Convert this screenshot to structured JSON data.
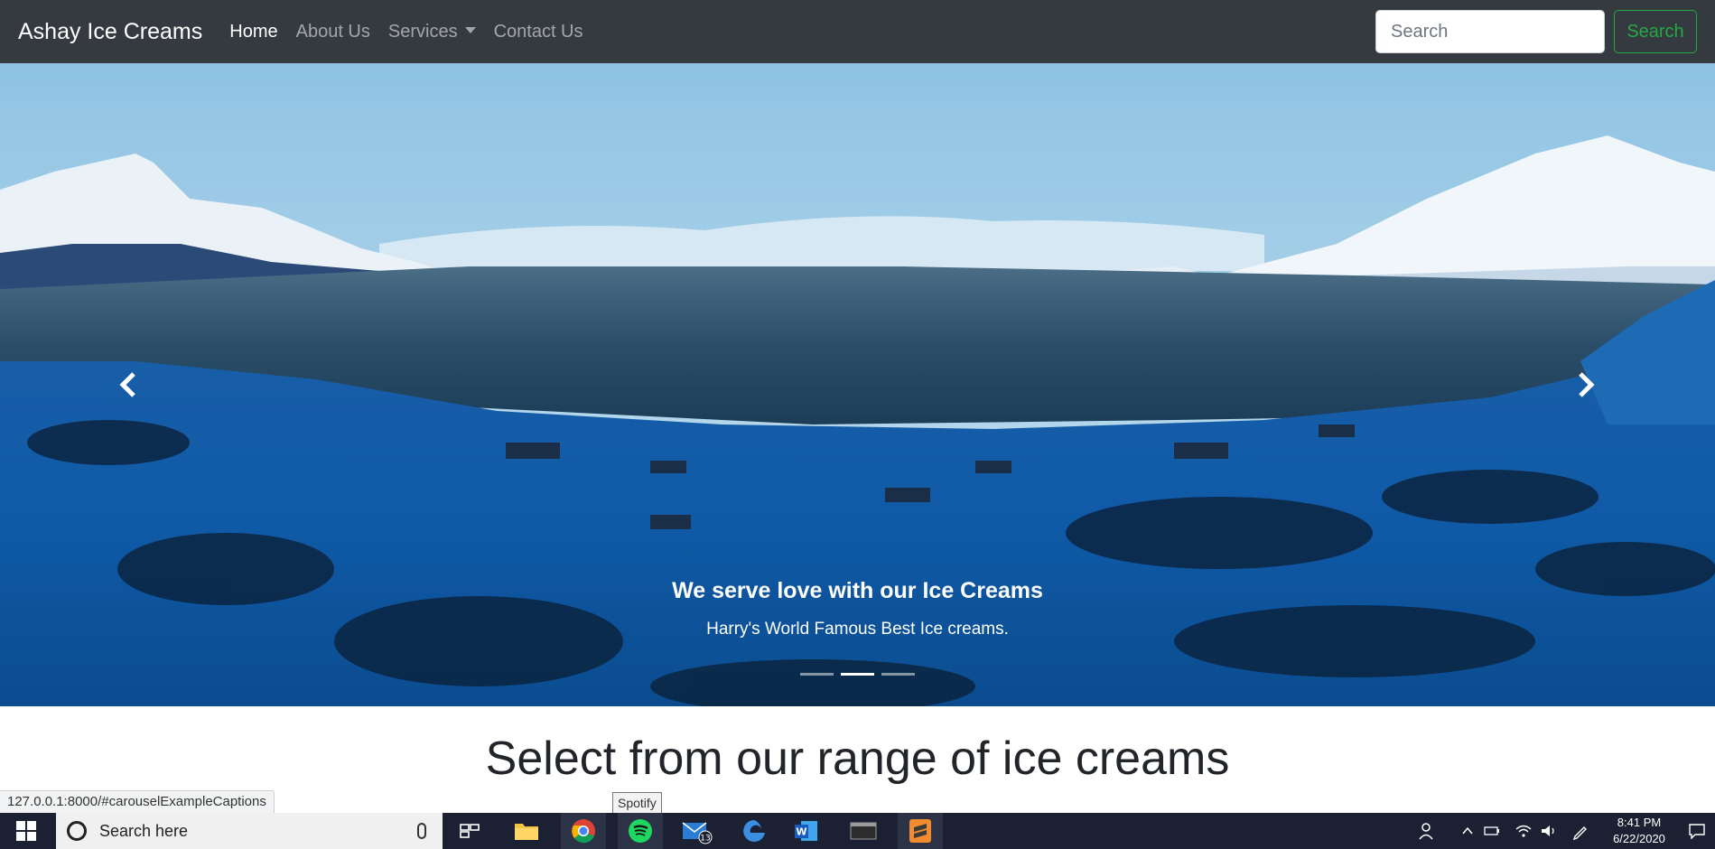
{
  "navbar": {
    "brand": "Ashay Ice Creams",
    "links": [
      {
        "label": "Home",
        "active": true
      },
      {
        "label": "About Us",
        "active": false
      },
      {
        "label": "Services",
        "active": false,
        "dropdown": true
      },
      {
        "label": "Contact Us",
        "active": false
      }
    ],
    "search_placeholder": "Search",
    "search_button": "Search"
  },
  "carousel": {
    "caption_title": "We serve love with our Ice Creams",
    "caption_text": "Harry's World Famous Best Ice creams.",
    "slide_count": 3,
    "active_slide": 1,
    "prev_icon": "chevron-left-icon",
    "next_icon": "chevron-right-icon"
  },
  "section": {
    "heading": "Select from our range of ice creams"
  },
  "browser": {
    "status_url": "127.0.0.1:8000/#carouselExampleCaptions",
    "tooltip": "Spotify"
  },
  "taskbar": {
    "search_placeholder": "Search here",
    "apps": [
      "task-view",
      "file-explorer",
      "chrome",
      "spotify",
      "mail",
      "edge",
      "word",
      "terminal",
      "sublime-text"
    ],
    "mail_badge": "13",
    "time": "8:41 PM",
    "date": "6/22/2020"
  },
  "colors": {
    "navbar_bg": "#343a40",
    "success": "#28a745",
    "taskbar_bg": "#1b2033"
  }
}
